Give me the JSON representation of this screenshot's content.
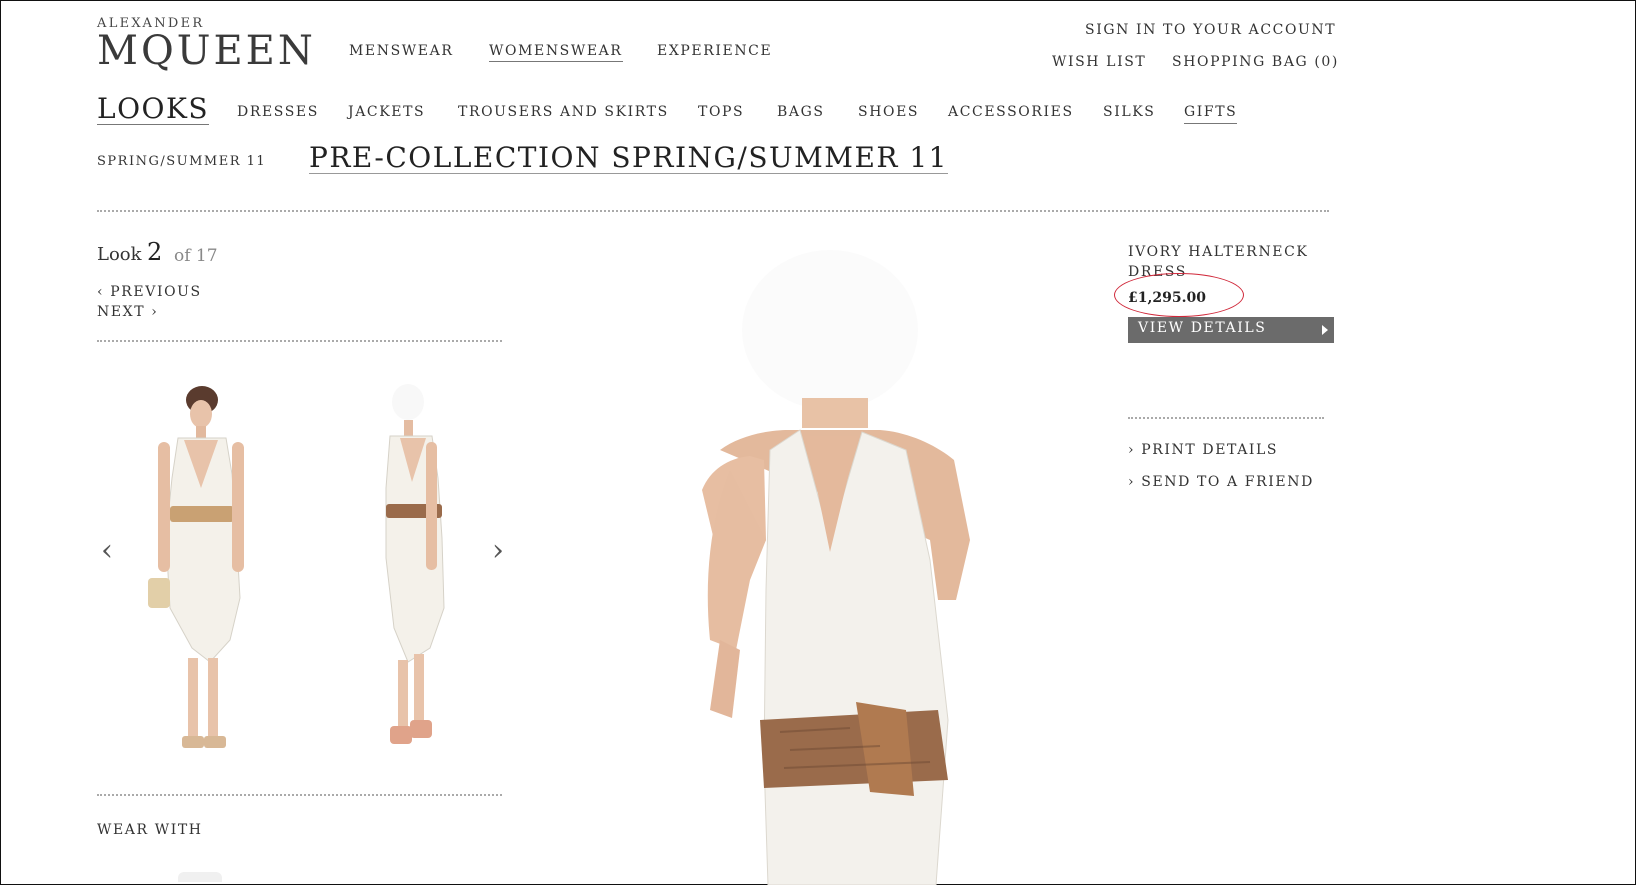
{
  "brand": {
    "top": "ALEXANDER",
    "main": "MQUEEN"
  },
  "top_nav": [
    "MENSWEAR",
    "WOMENSWEAR",
    "EXPERIENCE"
  ],
  "account": {
    "sign_in": "SIGN IN TO YOUR ACCOUNT",
    "wish_list": "WISH LIST",
    "bag": "SHOPPING BAG (0)"
  },
  "categories": {
    "looks": "LOOKS",
    "items": [
      "DRESSES",
      "JACKETS",
      "TROUSERS AND SKIRTS",
      "TOPS",
      "BAGS",
      "SHOES",
      "ACCESSORIES",
      "SILKS",
      "GIFTS"
    ]
  },
  "season": "SPRING/SUMMER 11",
  "collection_title": "PRE-COLLECTION SPRING/SUMMER 11",
  "look": {
    "word": "Look",
    "number": "2",
    "of_total": "of 17"
  },
  "pager": {
    "previous": "‹ PREVIOUS",
    "next": "NEXT ›"
  },
  "product": {
    "name": "IVORY HALTERNECK DRESS",
    "price": "£1,295.00",
    "view_details": "VIEW DETAILS"
  },
  "side_links": {
    "print": "PRINT DETAILS",
    "send": "SEND TO A FRIEND"
  },
  "wear_with": "WEAR WITH",
  "carousel": {
    "prev_arrow": "‹",
    "next_arrow": "›"
  },
  "colors": {
    "price_ring": "#d0283a",
    "button": "#6b6b6b",
    "belt": "#9a6b4b"
  },
  "icons": [
    "chevron-left-icon",
    "chevron-right-icon",
    "triangle-right-icon"
  ]
}
